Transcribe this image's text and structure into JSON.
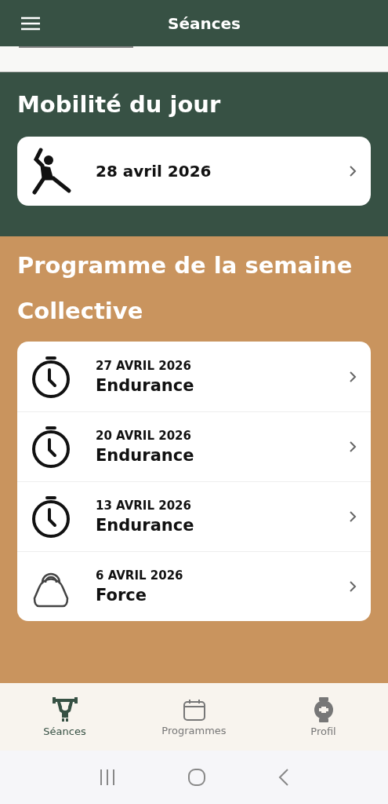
{
  "header": {
    "title": "Séances"
  },
  "mobility": {
    "title": "Mobilité du jour",
    "date": "28 avril 2026"
  },
  "week": {
    "title": "Programme de la semaine",
    "subtitle": "Collective",
    "sessions": [
      {
        "kind": "timer",
        "date": "27 AVRIL 2026",
        "name": "Endurance"
      },
      {
        "kind": "timer",
        "date": "20 AVRIL 2026",
        "name": "Endurance"
      },
      {
        "kind": "timer",
        "date": "13 AVRIL 2026",
        "name": "Endurance"
      },
      {
        "kind": "kettlebell",
        "date": "6 AVRIL 2026",
        "name": "Force"
      }
    ]
  },
  "nav": [
    {
      "kind": "lifter",
      "label": "Séances",
      "selected": true
    },
    {
      "kind": "calendar",
      "label": "Programmes",
      "selected": false
    },
    {
      "kind": "watch",
      "label": "Profil",
      "selected": false
    }
  ]
}
